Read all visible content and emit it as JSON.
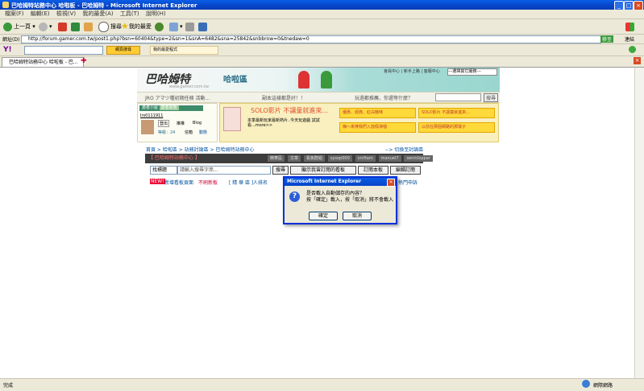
{
  "window": {
    "title": "巴哈姆特站務中心 哈啦板 - 巴哈姆特 - Microsoft Internet Explorer"
  },
  "menubar": {
    "items": [
      "檔案(F)",
      "編輯(E)",
      "檢視(V)",
      "我的最愛(A)",
      "工具(T)",
      "說明(H)"
    ]
  },
  "toolbar": {
    "back": "上一頁",
    "search": "搜尋",
    "favorites": "我的最愛"
  },
  "addressbar": {
    "label": "網址(D)",
    "url": "http://forum.gamer.com.tw/post1.php?bsn=60404&type=2&sn=1&snA=6482&sna=25842&snbbrow=0&tnedaw=0",
    "go": "移至",
    "links": "連結"
  },
  "yahoobar": {
    "search_button": "網頁搜尋",
    "favorites": "我的最愛程式"
  },
  "tabs": [
    {
      "label": "巴哈姆特站務中心 哈啦板 - 巴..."
    }
  ],
  "site": {
    "logo": "巴哈姆特",
    "logo_sub": "www.gamer.com.tw",
    "zone": "哈啦區",
    "toplinks": "會員中心 | 新手上路 | 客服中心",
    "server_select": "---選擇其它服務---",
    "slogan_left": "JRO アマツ種初期任務 活動...",
    "slogan_mid": "副本這樣都是好！！",
    "slogan_right": "玩過都推薦，你還等什麼？",
    "slogan_button": "搜尋",
    "user": {
      "greeting": "勇者小屋",
      "status": "勇者狀態",
      "name": "Irs0111911",
      "logout": "登出",
      "hint": "推推",
      "blog": "Blog",
      "level": "等級：24",
      "email": "信箱",
      "activity": "動態"
    },
    "ad": {
      "title": "SOLO影片 不讓童就進來...",
      "desc": "本季最新玩家最新熱片..今天玩遊戲 試試看...more>>",
      "buttons": [
        "優惠、經典、紅白機味",
        "SOLO影片 不讓童就進來...",
        "嗨～來捧我們入放假演唱",
        "以前在那個網路的那樣子"
      ]
    },
    "breadcrumb": "首頁 > 哈啦區 > 站務討論區 > 巴哈姆特站務中心",
    "breadcrumb_right": "--> 切換至討論區",
    "board": {
      "name": "【 巴哈姆特站務中心 】",
      "tags": [
        "精華區",
        "文章",
        "看板群組",
        "sysop000",
        "crcftam",
        "manuel7",
        "senrcloppar"
      ]
    },
    "search": {
      "select": "找標題",
      "placeholder": "請輸入搜尋字串...",
      "search_btn": "搜尋",
      "show_btn": "顯示我曾訂閱的看板",
      "subscribe_btn": "訂閱本板",
      "edit_btn": "編輯訂閱"
    },
    "links": {
      "new": "NEW!",
      "new_text": "新增看板頁面",
      "hot": "不刷新板",
      "picks": "[ 精 華 區 ]",
      "rank": "人排名",
      "report": "熱門申訴"
    }
  },
  "dialog": {
    "title": "Microsoft Internet Explorer",
    "message_line1": "是否載入自動儲存的內容？",
    "message_line2": "按「確定」載入，按「取消」將不會載入",
    "ok": "確定",
    "cancel": "取消"
  },
  "statusbar": {
    "left": "完成",
    "right": "網際網路"
  }
}
